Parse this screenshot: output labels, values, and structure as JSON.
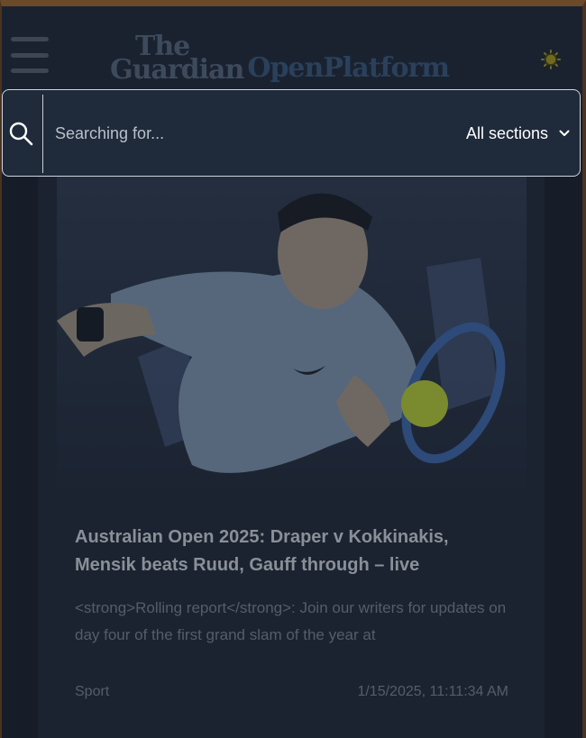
{
  "header": {
    "logo_word_top": "The",
    "logo_word_bottom": "Guardian",
    "logo_platform": "OpenPlatform",
    "menu_icon": "hamburger-menu-icon",
    "theme_icon": "sun-icon"
  },
  "search": {
    "icon": "search-icon",
    "placeholder": "Searching for...",
    "value": "",
    "section_selected": "All sections",
    "section_icon": "chevron-down-icon"
  },
  "article": {
    "image_subject": "tennis player hitting forehand",
    "title": "Australian Open 2025: Draper v Kokkinakis, Mensik beats Ruud, Gauff through – live",
    "description": "<strong>Rolling report</strong>: Join our writers for updates on day four of the first grand slam of the year at",
    "section": "Sport",
    "date": "1/15/2025, 11:11:34 AM"
  },
  "colors": {
    "background": "#161d29",
    "header": "#1a2230",
    "search_bg": "#1f2a3a",
    "card_bg": "#1b2331",
    "title_text": "#8a9097",
    "muted_text": "#555d68"
  }
}
